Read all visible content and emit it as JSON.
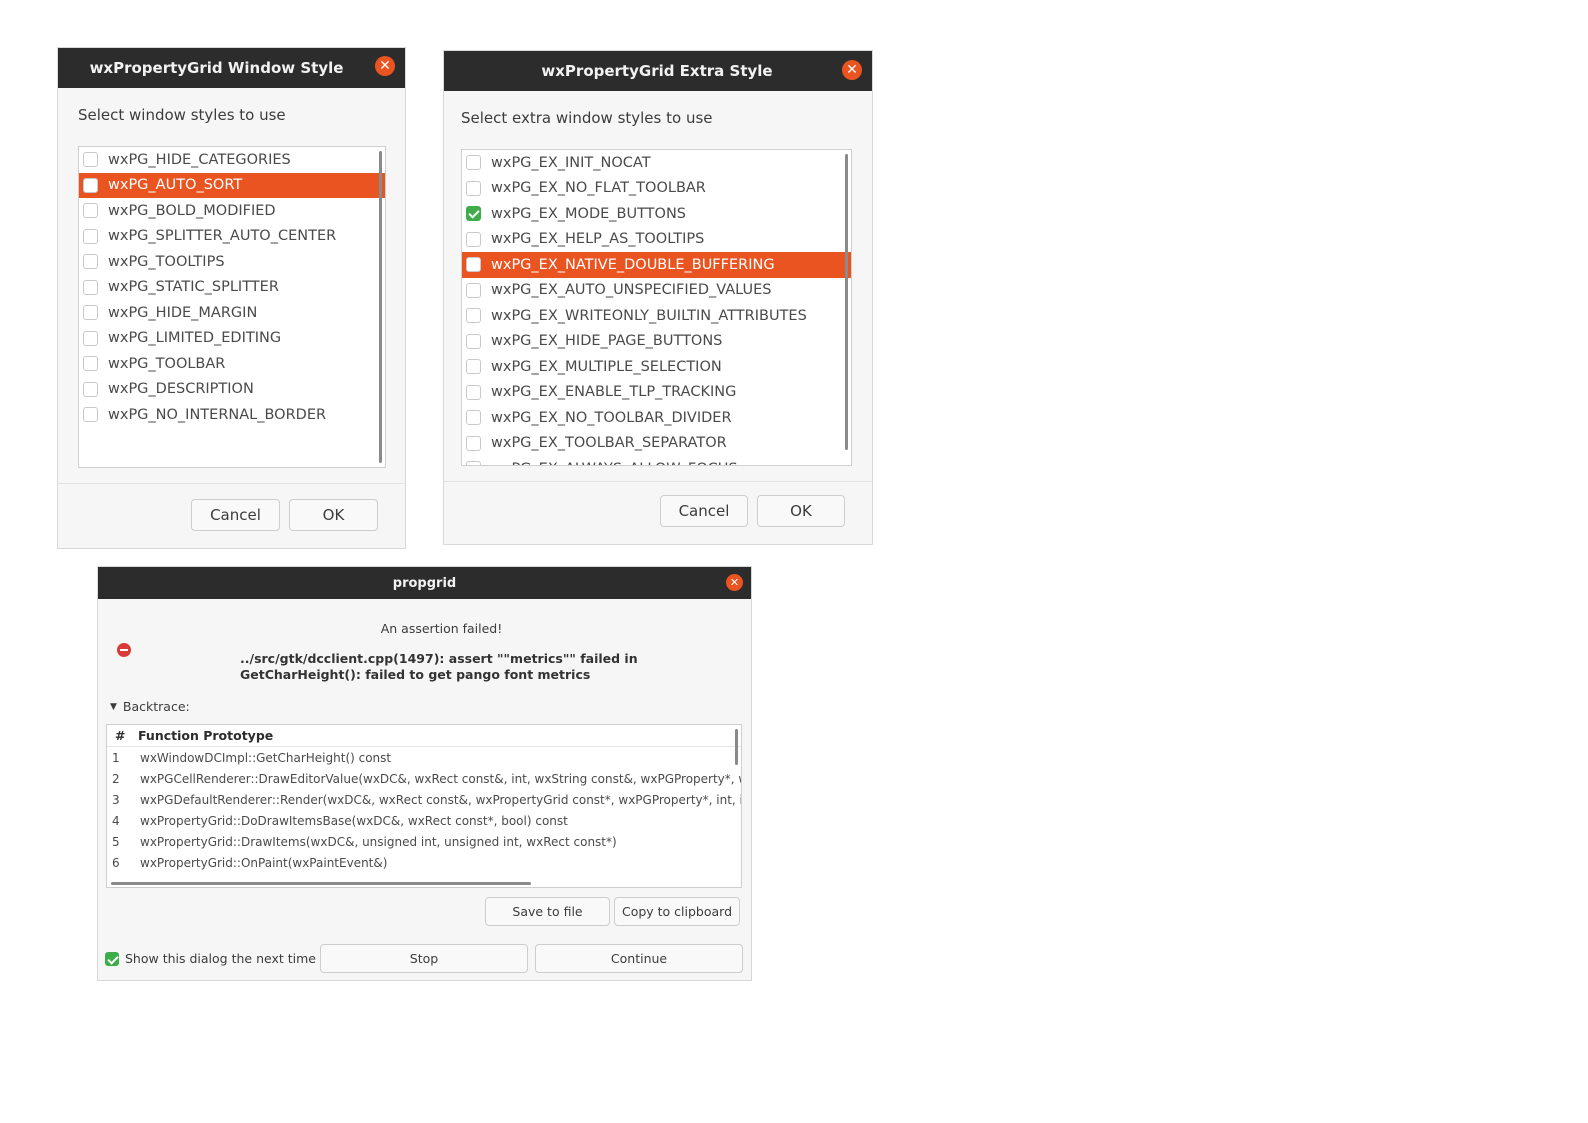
{
  "window_style_dialog": {
    "title": "wxPropertyGrid Window Style",
    "prompt": "Select window styles to use",
    "items": [
      {
        "label": "wxPG_HIDE_CATEGORIES",
        "checked": false,
        "selected": false
      },
      {
        "label": "wxPG_AUTO_SORT",
        "checked": false,
        "selected": true
      },
      {
        "label": "wxPG_BOLD_MODIFIED",
        "checked": false,
        "selected": false
      },
      {
        "label": "wxPG_SPLITTER_AUTO_CENTER",
        "checked": false,
        "selected": false
      },
      {
        "label": "wxPG_TOOLTIPS",
        "checked": false,
        "selected": false
      },
      {
        "label": "wxPG_STATIC_SPLITTER",
        "checked": false,
        "selected": false
      },
      {
        "label": "wxPG_HIDE_MARGIN",
        "checked": false,
        "selected": false
      },
      {
        "label": "wxPG_LIMITED_EDITING",
        "checked": false,
        "selected": false
      },
      {
        "label": "wxPG_TOOLBAR",
        "checked": false,
        "selected": false
      },
      {
        "label": "wxPG_DESCRIPTION",
        "checked": false,
        "selected": false
      },
      {
        "label": "wxPG_NO_INTERNAL_BORDER",
        "checked": false,
        "selected": false
      }
    ],
    "cancel_label": "Cancel",
    "ok_label": "OK"
  },
  "extra_style_dialog": {
    "title": "wxPropertyGrid Extra Style",
    "prompt": "Select extra window styles to use",
    "items": [
      {
        "label": "wxPG_EX_INIT_NOCAT",
        "checked": false,
        "selected": false
      },
      {
        "label": "wxPG_EX_NO_FLAT_TOOLBAR",
        "checked": false,
        "selected": false
      },
      {
        "label": "wxPG_EX_MODE_BUTTONS",
        "checked": true,
        "selected": false
      },
      {
        "label": "wxPG_EX_HELP_AS_TOOLTIPS",
        "checked": false,
        "selected": false
      },
      {
        "label": "wxPG_EX_NATIVE_DOUBLE_BUFFERING",
        "checked": false,
        "selected": true
      },
      {
        "label": "wxPG_EX_AUTO_UNSPECIFIED_VALUES",
        "checked": false,
        "selected": false
      },
      {
        "label": "wxPG_EX_WRITEONLY_BUILTIN_ATTRIBUTES",
        "checked": false,
        "selected": false
      },
      {
        "label": "wxPG_EX_HIDE_PAGE_BUTTONS",
        "checked": false,
        "selected": false
      },
      {
        "label": "wxPG_EX_MULTIPLE_SELECTION",
        "checked": false,
        "selected": false
      },
      {
        "label": "wxPG_EX_ENABLE_TLP_TRACKING",
        "checked": false,
        "selected": false
      },
      {
        "label": "wxPG_EX_NO_TOOLBAR_DIVIDER",
        "checked": false,
        "selected": false
      },
      {
        "label": "wxPG_EX_TOOLBAR_SEPARATOR",
        "checked": false,
        "selected": false
      },
      {
        "label": "wxPG_EX_ALWAYS_ALLOW_FOCUS",
        "checked": false,
        "selected": false
      }
    ],
    "cancel_label": "Cancel",
    "ok_label": "OK"
  },
  "assert_dialog": {
    "title": "propgrid",
    "heading": "An assertion failed!",
    "message_line1": "../src/gtk/dcclient.cpp(1497): assert \"\"metrics\"\" failed in",
    "message_line2": "GetCharHeight(): failed to get pango font metrics",
    "backtrace_label": "Backtrace:",
    "columns": [
      "#",
      "Function Prototype"
    ],
    "rows": [
      {
        "num": "1",
        "proto": "wxWindowDCImpl::GetCharHeight() const"
      },
      {
        "num": "2",
        "proto": "wxPGCellRenderer::DrawEditorValue(wxDC&, wxRect const&, int, wxString const&, wxPGProperty*, wxPGEditor const*) const"
      },
      {
        "num": "3",
        "proto": "wxPGDefaultRenderer::Render(wxDC&, wxRect const&, wxPropertyGrid const*, wxPGProperty*, int, int, int) const"
      },
      {
        "num": "4",
        "proto": "wxPropertyGrid::DoDrawItemsBase(wxDC&, wxRect const*, bool) const"
      },
      {
        "num": "5",
        "proto": "wxPropertyGrid::DrawItems(wxDC&, unsigned int, unsigned int, wxRect const*)"
      },
      {
        "num": "6",
        "proto": "wxPropertyGrid::OnPaint(wxPaintEvent&)"
      }
    ],
    "save_label": "Save to file",
    "copy_label": "Copy to clipboard",
    "show_next_label": "Show this dialog the next time",
    "show_next_checked": true,
    "stop_label": "Stop",
    "continue_label": "Continue"
  }
}
